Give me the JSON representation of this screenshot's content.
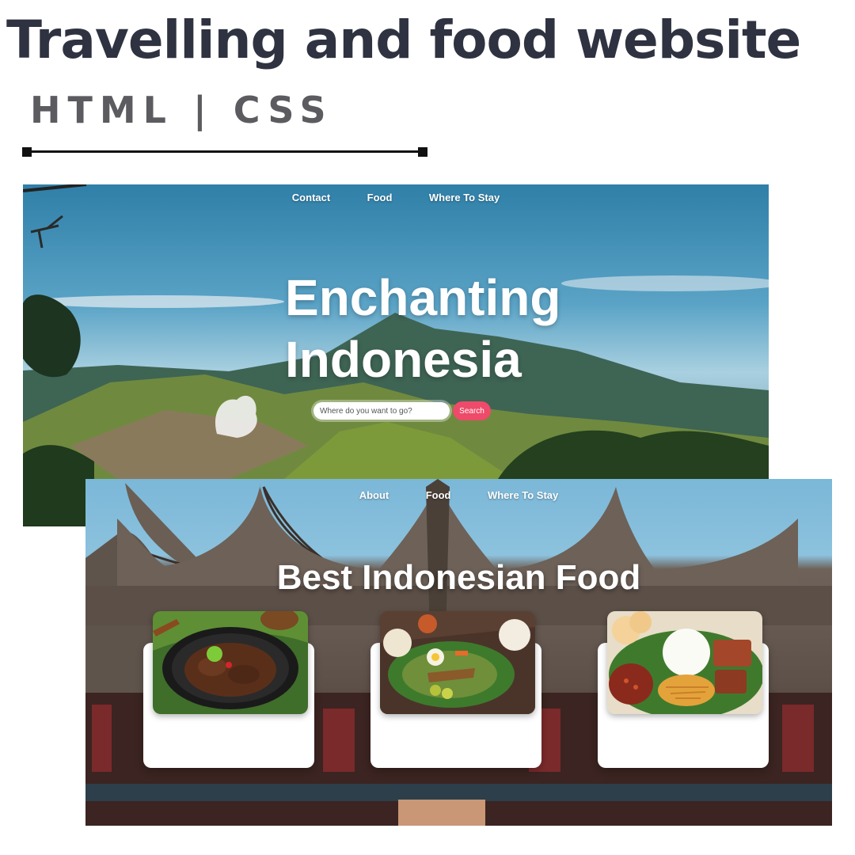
{
  "heading": {
    "title": "Travelling and food website",
    "subtitle": "HTML | CSS"
  },
  "travel_page": {
    "nav": [
      "Contact",
      "Food",
      "Where To Stay"
    ],
    "hero_title_line1": "Enchanting",
    "hero_title_line2": "Indonesia",
    "search": {
      "placeholder": "Where do you want to go?",
      "button_label": "Search"
    }
  },
  "food_page": {
    "nav": [
      "About",
      "Food",
      "Where To Stay"
    ],
    "title": "Best Indonesian Food",
    "cards": [
      {
        "photo": "rendang-dish-photo"
      },
      {
        "photo": "gado-gado-dish-photo"
      },
      {
        "photo": "nasi-campur-dish-photo"
      }
    ]
  },
  "colors": {
    "title_text": "#2f3240",
    "subtitle_text": "#5b5b60",
    "search_button": "#ee4a6a"
  }
}
